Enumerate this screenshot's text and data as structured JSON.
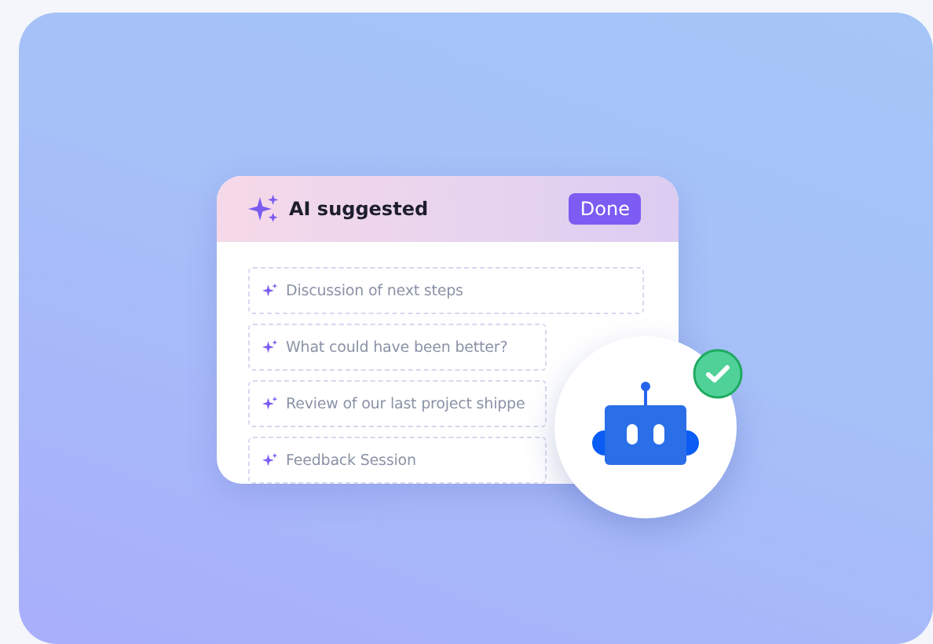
{
  "card": {
    "title": "AI suggested",
    "done_button": "Done",
    "suggestions": [
      "Discussion of next steps",
      "What could have been better?",
      "Review of our last project shippe",
      "Feedback Session"
    ]
  },
  "robot_badge": {
    "verified": true
  }
}
